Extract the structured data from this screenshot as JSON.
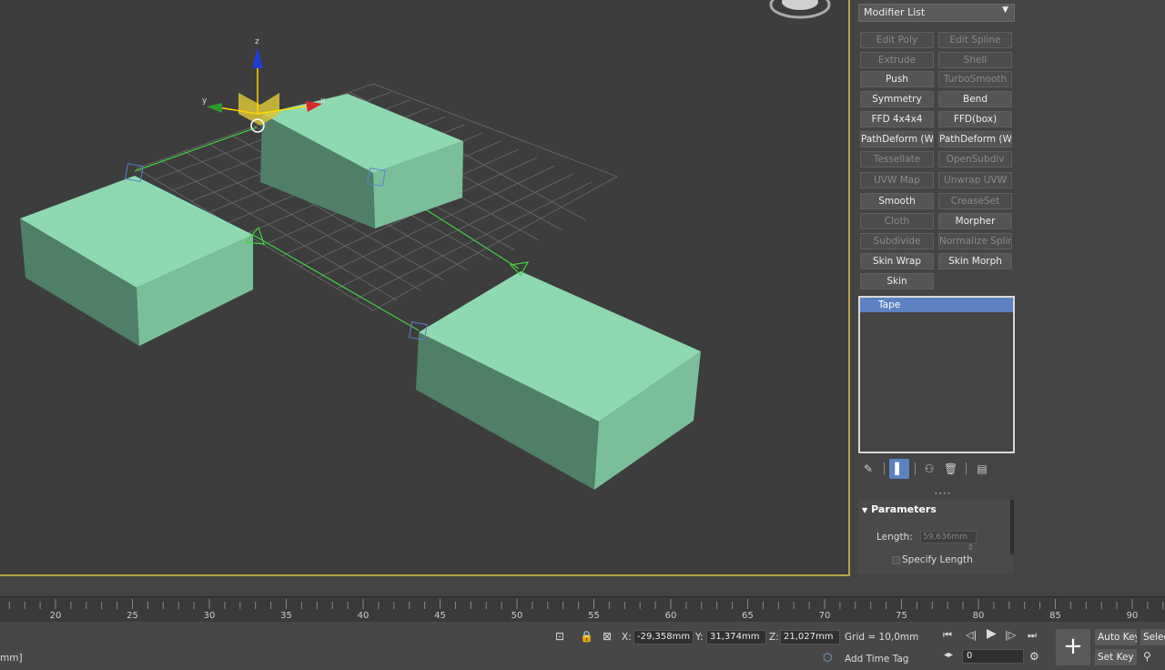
{
  "viewport": {
    "axes": {
      "x": "x",
      "y": "y",
      "z": "z"
    }
  },
  "command_panel": {
    "modifier_list": "Modifier List",
    "buttons": [
      {
        "label": "Edit Poly",
        "enabled": false
      },
      {
        "label": "Edit Spline",
        "enabled": false
      },
      {
        "label": "Extrude",
        "enabled": false
      },
      {
        "label": "Shell",
        "enabled": false
      },
      {
        "label": "Push",
        "enabled": true
      },
      {
        "label": "TurboSmooth",
        "enabled": false
      },
      {
        "label": "Symmetry",
        "enabled": true
      },
      {
        "label": "Bend",
        "enabled": true
      },
      {
        "label": "FFD 4x4x4",
        "enabled": true
      },
      {
        "label": "FFD(box)",
        "enabled": true
      },
      {
        "label": "PathDeform (WSM",
        "enabled": true
      },
      {
        "label": "PathDeform (WSM",
        "enabled": true
      },
      {
        "label": "Tessellate",
        "enabled": false
      },
      {
        "label": "OpenSubdiv",
        "enabled": false
      },
      {
        "label": "UVW Map",
        "enabled": false
      },
      {
        "label": "Unwrap UVW",
        "enabled": false
      },
      {
        "label": "Smooth",
        "enabled": true
      },
      {
        "label": "CreaseSet",
        "enabled": false
      },
      {
        "label": "Cloth",
        "enabled": false
      },
      {
        "label": "Morpher",
        "enabled": true
      },
      {
        "label": "Subdivide",
        "enabled": false
      },
      {
        "label": "Normalize Spline",
        "enabled": false
      },
      {
        "label": "Skin Wrap",
        "enabled": true
      },
      {
        "label": "Skin Morph",
        "enabled": true
      },
      {
        "label": "Skin",
        "enabled": true
      }
    ],
    "stack_item": "Tape",
    "parameters": {
      "title": "Parameters",
      "length_label": "Length:",
      "length_value": "59,636mm",
      "specify_length": "Specify Length"
    }
  },
  "timeline": {
    "ticks": [
      "20",
      "25",
      "30",
      "35",
      "40",
      "45",
      "50",
      "55",
      "60",
      "65",
      "70",
      "75",
      "80",
      "85",
      "90"
    ]
  },
  "status_bar": {
    "prompt": "mm]",
    "x_label": "X:",
    "x_value": "-29,358mm",
    "y_label": "Y:",
    "y_value": "31,374mm",
    "z_label": "Z:",
    "z_value": "21,027mm",
    "grid": "Grid = 10,0mm",
    "add_time_tag": "Add Time Tag",
    "frame": "0",
    "auto_key": "Auto Key",
    "set_key": "Set Key",
    "selected": "Selec"
  },
  "colors": {
    "viewport_bg": "#3d3d3d",
    "box_top": "#8fd9b0",
    "box_side_dark": "#4f7f67",
    "box_side_mid": "#7bbf9a",
    "tape_line": "#3fd23f",
    "selection_blue": "#5c82c1",
    "viewport_border": "#b8a04a"
  }
}
